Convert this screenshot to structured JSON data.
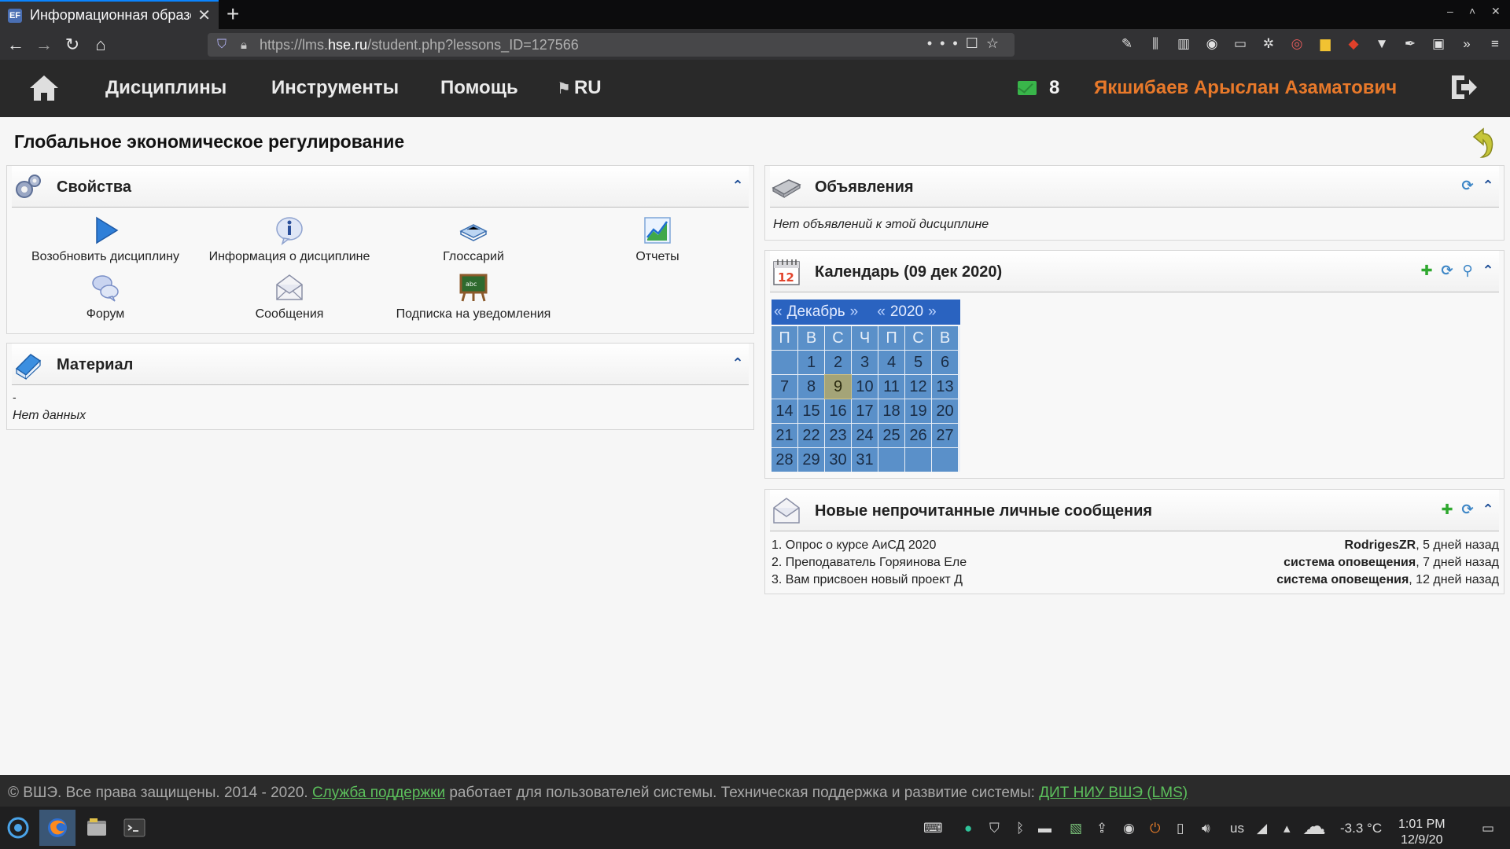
{
  "browser": {
    "tab_title": "Информационная образо",
    "tab_favicon": "ЕF",
    "url_prefix": "https://lms.",
    "url_domain": "hse.ru",
    "url_path": "/student.php?lessons_ID=127566"
  },
  "header": {
    "menu": [
      "Дисциплины",
      "Инструменты",
      "Помощь"
    ],
    "lang": "RU",
    "unread_count": "8",
    "user_name": "Якшибаев Арыслан Азаматович"
  },
  "page": {
    "title": "Глобальное экономическое регулирование"
  },
  "properties": {
    "title": "Свойства",
    "items": [
      "Возобновить дисциплину",
      "Информация о дисциплине",
      "Глоссарий",
      "Отчеты",
      "Форум",
      "Сообщения",
      "Подписка на уведомления"
    ]
  },
  "material": {
    "title": "Материал",
    "dash": "-",
    "empty": "Нет данных"
  },
  "announcements": {
    "title": "Объявления",
    "empty": "Нет объявлений к этой дисциплине"
  },
  "calendar": {
    "title": "Календарь (09 дек 2020)",
    "month": "Декабрь",
    "year": "2020",
    "prev": "«",
    "next": "»",
    "weekdays": [
      "П",
      "В",
      "С",
      "Ч",
      "П",
      "С",
      "В"
    ],
    "weeks": [
      [
        "",
        "1",
        "2",
        "3",
        "4",
        "5",
        "6"
      ],
      [
        "7",
        "8",
        "9",
        "10",
        "11",
        "12",
        "13"
      ],
      [
        "14",
        "15",
        "16",
        "17",
        "18",
        "19",
        "20"
      ],
      [
        "21",
        "22",
        "23",
        "24",
        "25",
        "26",
        "27"
      ],
      [
        "28",
        "29",
        "30",
        "31",
        "",
        "",
        ""
      ]
    ],
    "today": "9"
  },
  "messages": {
    "title": "Новые непрочитанные личные сообщения",
    "items": [
      {
        "num": "1.",
        "subject": "Опрос о курсе АиСД 2020",
        "sender": "RodrigesZR",
        "when": ", 5 дней назад"
      },
      {
        "num": "2.",
        "subject": "Преподаватель Горяинова Еле",
        "sender": "система оповещения",
        "when": ", 7 дней назад"
      },
      {
        "num": "3.",
        "subject": "Вам присвоен новый проект Д",
        "sender": "система оповещения",
        "when": ", 12 дней назад"
      }
    ]
  },
  "footer": {
    "copyright": "© ВШЭ. Все права защищены. 2014 - 2020.",
    "support_link": "Служба поддержки",
    "middle": "работает для пользователей системы.",
    "tech": "Техническая поддержка и развитие системы:",
    "dit_link": "ДИТ НИУ ВШЭ (LMS)"
  },
  "taskbar": {
    "keyboard": "us",
    "weather": "-3.3 °C",
    "time": "1:01 PM",
    "date": "12/9/20"
  },
  "colors": {
    "accent_user": "#e8792a",
    "link_green": "#5cc05c",
    "calendar_blue": "#5a90c9"
  }
}
